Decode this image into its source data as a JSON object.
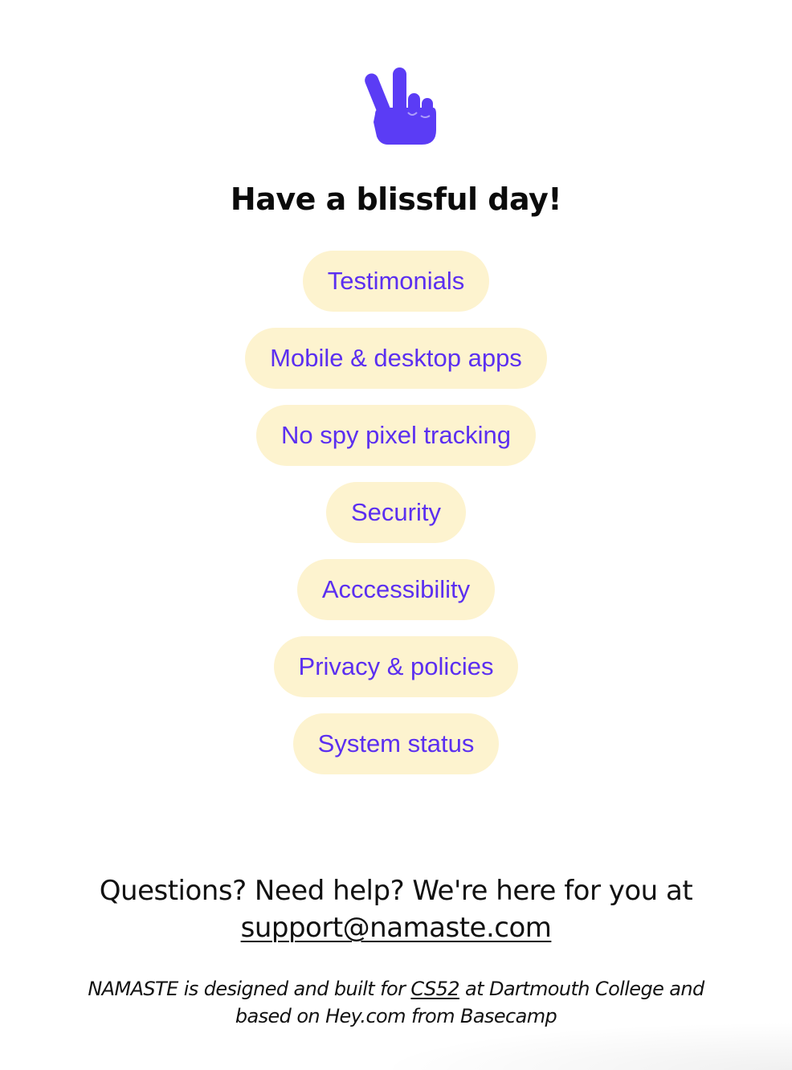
{
  "icon": {
    "name": "peace-hand-icon",
    "color": "#5b3cf5"
  },
  "greeting": "Have a blissful day!",
  "nav": {
    "items": [
      {
        "label": "Testimonials"
      },
      {
        "label": "Mobile & desktop apps"
      },
      {
        "label": "No spy pixel tracking"
      },
      {
        "label": "Security"
      },
      {
        "label": "Acccessibility"
      },
      {
        "label": "Privacy & policies"
      },
      {
        "label": "System status"
      }
    ],
    "pill_bg": "#fdf3cf",
    "text_color": "#5b2ff0"
  },
  "help": {
    "prefix": "Questions? Need help? We're here for you at",
    "email": "support@namaste.com"
  },
  "credits": {
    "before": "NAMASTE is designed and built for",
    "course": "CS52",
    "after": "at Dartmouth College and based on Hey.com from Basecamp"
  }
}
